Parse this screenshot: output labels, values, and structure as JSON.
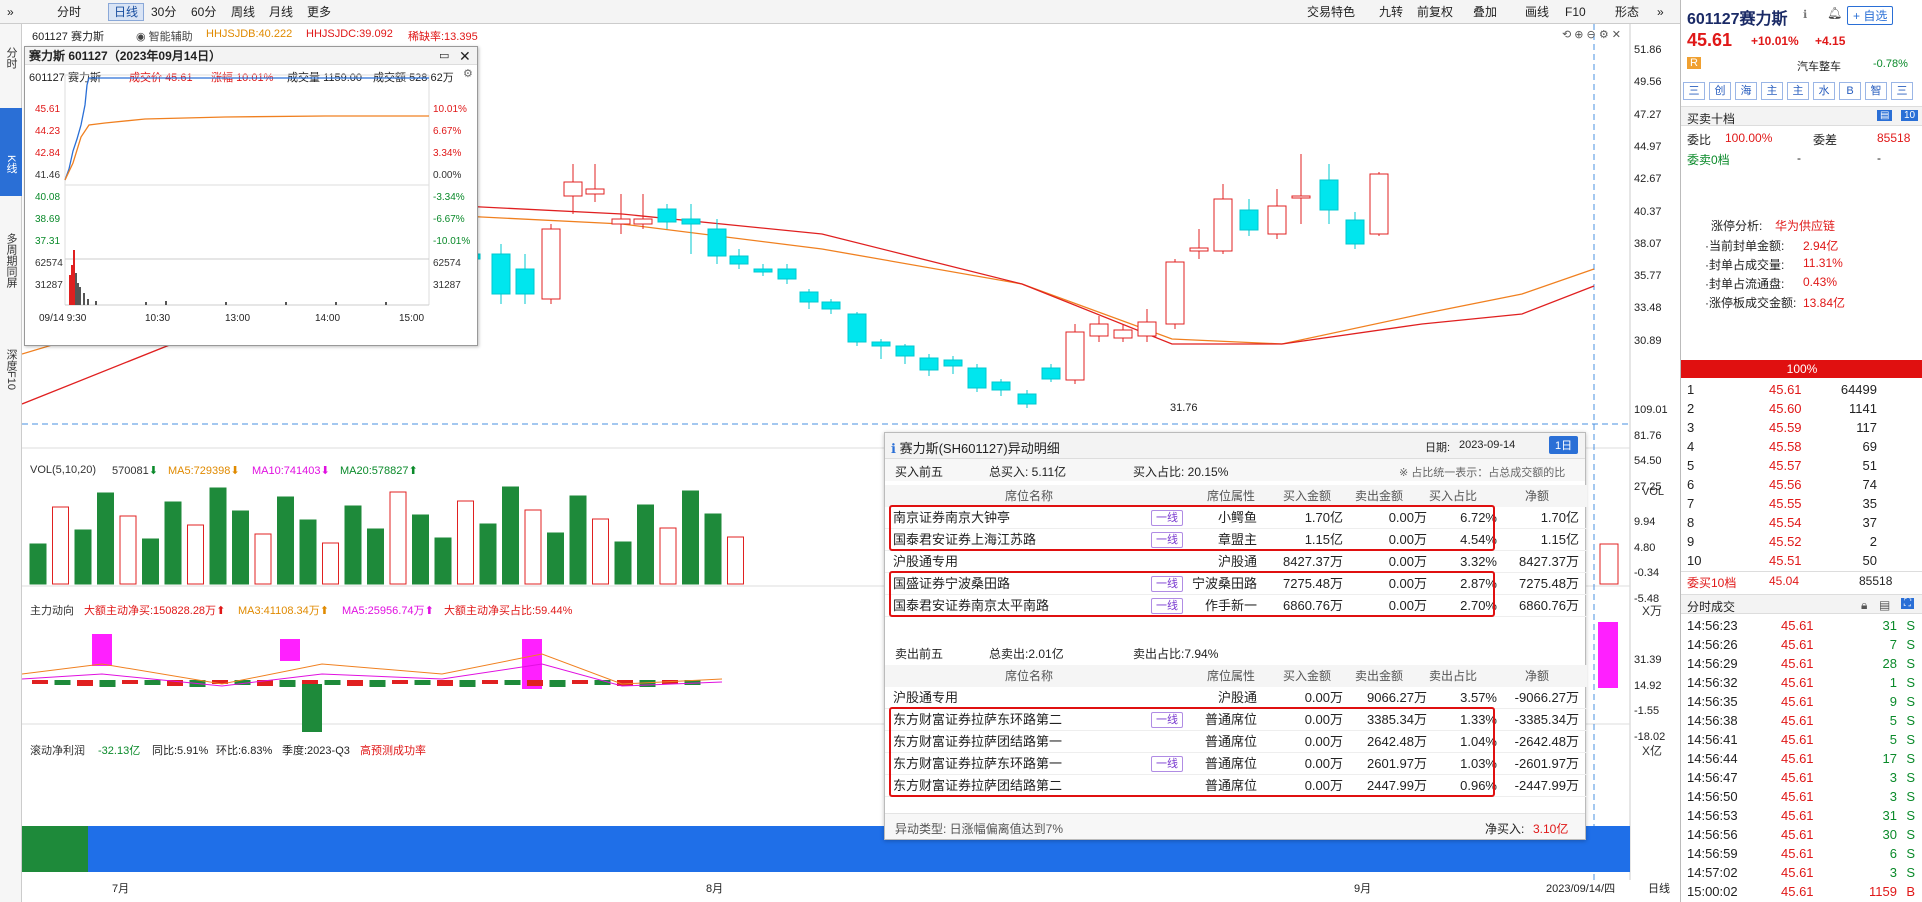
{
  "toolbar": {
    "periods": [
      "分时",
      "日线",
      "30分",
      "60分",
      "周线",
      "月线",
      "更多"
    ],
    "active": "日线",
    "right": [
      "交易特色",
      "九转",
      "前复权",
      "叠加",
      "画线",
      "F10",
      "形态"
    ]
  },
  "left_strip": {
    "top": "分时",
    "k": "K线",
    "multi": "多周期同屏",
    "depth": "深度F10"
  },
  "header": {
    "code": "601127",
    "name": "赛力斯",
    "assist": "智能辅助",
    "ind1": "HHJSJDB:40.222",
    "ind2": "HHJSJDC:39.092",
    "ind3": "稀缺率:13.395"
  },
  "main_axis": [
    "51.86",
    "49.56",
    "47.27",
    "44.97",
    "42.67",
    "40.37",
    "38.07",
    "35.77",
    "33.48",
    "30.89"
  ],
  "low_label": "31.76",
  "vol_legend": {
    "vol": "VOL(5,10,20)",
    "v": "570081",
    "ma5": "MA5:729398",
    "ma10": "MA10:741403",
    "ma20": "MA20:578827"
  },
  "vol_axis": [
    "109.01",
    "81.76",
    "54.50",
    "27.25"
  ],
  "vol_unit": "X万",
  "flow_legend": {
    "t": "主力动向",
    "a": "大额主动净买:150828.28万",
    "b": "MA3:41108.34万",
    "c": "MA5:25956.74万",
    "d": "大额主动净买占比:59.44%"
  },
  "flow_axis": [
    "9.94",
    "4.80",
    "-0.34",
    "-5.48"
  ],
  "flow_unit": "X亿",
  "profit_legend": {
    "t": "滚动净利润",
    "v": "-32.13亿",
    "yoy": "同比:5.91%",
    "qoq": "环比:6.83%",
    "q": "季度:2023-Q3",
    "pred": "高预测成功率"
  },
  "profit_axis": [
    "31.39",
    "14.92",
    "-1.55",
    "-18.02"
  ],
  "months": [
    "7月",
    "8月",
    "9月"
  ],
  "date_stamp": "2023/09/14/四",
  "bottom_tab": "日线",
  "mini": {
    "title": "赛力斯 601127（2023年09月14日）",
    "code": "601127 赛力斯",
    "price_l": "成交价",
    "price": "45.61",
    "chg_l": "涨幅",
    "chg": "10.01%",
    "vol_l": "成交量",
    "vol": "1159.00",
    "amt_l": "成交额",
    "amt": "528.62万",
    "left": [
      "45.61",
      "44.23",
      "42.84",
      "41.46",
      "40.08",
      "38.69",
      "37.31",
      "62574",
      "31287"
    ],
    "right": [
      "10.01%",
      "6.67%",
      "3.34%",
      "0.00%",
      "-3.34%",
      "-6.67%",
      "-10.01%",
      "62574",
      "31287"
    ],
    "times": [
      "09/14 9:30",
      "10:30",
      "13:00",
      "14:00",
      "15:00"
    ]
  },
  "popup": {
    "title": "赛力斯(SH601127)异动明细",
    "date_l": "日期:",
    "date": "2023-09-14",
    "day_btn": "1日",
    "buy": {
      "label": "买入前五",
      "total": "总买入: 5.11亿",
      "ratio": "买入占比: 20.15%",
      "note": "※ 占比统一表示：占总成交额的比"
    },
    "headers": [
      "席位名称",
      "席位属性",
      "买入金额",
      "卖出金额",
      "买入占比",
      "净额"
    ],
    "sell_headers": [
      "席位名称",
      "席位属性",
      "买入金额",
      "卖出金额",
      "卖出占比",
      "净额"
    ],
    "buy_rows": [
      {
        "name": "南京证券南京大钟亭",
        "tag": "一线",
        "attr": "小鳄鱼",
        "buy": "1.70亿",
        "sell": "0.00万",
        "pct": "6.72%",
        "net": "1.70亿"
      },
      {
        "name": "国泰君安证券上海江苏路",
        "tag": "一线",
        "attr": "章盟主",
        "buy": "1.15亿",
        "sell": "0.00万",
        "pct": "4.54%",
        "net": "1.15亿"
      },
      {
        "name": "沪股通专用",
        "tag": "",
        "attr": "沪股通",
        "buy": "8427.37万",
        "sell": "0.00万",
        "pct": "3.32%",
        "net": "8427.37万"
      },
      {
        "name": "国盛证券宁波桑田路",
        "tag": "一线",
        "attr": "宁波桑田路",
        "buy": "7275.48万",
        "sell": "0.00万",
        "pct": "2.87%",
        "net": "7275.48万"
      },
      {
        "name": "国泰君安证券南京太平南路",
        "tag": "一线",
        "attr": "作手新一",
        "buy": "6860.76万",
        "sell": "0.00万",
        "pct": "2.70%",
        "net": "6860.76万"
      }
    ],
    "sell": {
      "label": "卖出前五",
      "total": "总卖出:2.01亿",
      "ratio": "卖出占比:7.94%"
    },
    "sell_rows": [
      {
        "name": "沪股通专用",
        "tag": "",
        "attr": "沪股通",
        "buy": "0.00万",
        "sell": "9066.27万",
        "pct": "3.57%",
        "net": "-9066.27万"
      },
      {
        "name": "东方财富证券拉萨东环路第二",
        "tag": "一线",
        "attr": "普通席位",
        "buy": "0.00万",
        "sell": "3385.34万",
        "pct": "1.33%",
        "net": "-3385.34万"
      },
      {
        "name": "东方财富证券拉萨团结路第一",
        "tag": "",
        "attr": "普通席位",
        "buy": "0.00万",
        "sell": "2642.48万",
        "pct": "1.04%",
        "net": "-2642.48万"
      },
      {
        "name": "东方财富证券拉萨东环路第一",
        "tag": "一线",
        "attr": "普通席位",
        "buy": "0.00万",
        "sell": "2601.97万",
        "pct": "1.03%",
        "net": "-2601.97万"
      },
      {
        "name": "东方财富证券拉萨团结路第二",
        "tag": "",
        "attr": "普通席位",
        "buy": "0.00万",
        "sell": "2447.99万",
        "pct": "0.96%",
        "net": "-2447.99万"
      }
    ],
    "footer_type": "异动类型: 日涨幅偏离值达到7%",
    "footer_net_l": "净买入:",
    "footer_net": "3.10亿"
  },
  "quote": {
    "title": "601127赛力斯",
    "add": "自选",
    "price": "45.61",
    "chg_pct": "+10.01%",
    "chg": "+4.15",
    "r_badge": "R",
    "sector": "汽车整车",
    "sector_chg": "-0.78%",
    "tabs": [
      "三",
      "创",
      "海",
      "主",
      "主",
      "水",
      "B",
      "智",
      "三"
    ],
    "book_title": "买卖十档",
    "wb_l": "委比",
    "wb": "100.00%",
    "wc_l": "委差",
    "wc": "85518",
    "sell0": "委卖0档",
    "dash": "-",
    "analysis_t": "涨停分析:",
    "analysis_v": "华为供应链",
    "stats": [
      {
        "l": "·当前封单金额:",
        "v": "2.94亿"
      },
      {
        "l": "·封单占成交量:",
        "v": "11.31%"
      },
      {
        "l": "·封单占流通盘:",
        "v": "0.43%"
      },
      {
        "l": "·涨停板成交金额:",
        "v": "13.84亿"
      }
    ],
    "bar": "100%",
    "bids": [
      {
        "n": "1",
        "p": "45.61",
        "q": "64499"
      },
      {
        "n": "2",
        "p": "45.60",
        "q": "1141"
      },
      {
        "n": "3",
        "p": "45.59",
        "q": "117"
      },
      {
        "n": "4",
        "p": "45.58",
        "q": "69"
      },
      {
        "n": "5",
        "p": "45.57",
        "q": "51"
      },
      {
        "n": "6",
        "p": "45.56",
        "q": "74"
      },
      {
        "n": "7",
        "p": "45.55",
        "q": "35"
      },
      {
        "n": "8",
        "p": "45.54",
        "q": "37"
      },
      {
        "n": "9",
        "p": "45.52",
        "q": "2"
      },
      {
        "n": "10",
        "p": "45.51",
        "q": "50"
      }
    ],
    "buy10_l": "委买10档",
    "buy10_p": "45.04",
    "buy10_q": "85518",
    "ticks_title": "分时成交",
    "ticks": [
      {
        "t": "14:56:23",
        "p": "45.61",
        "q": "31",
        "s": "S"
      },
      {
        "t": "14:56:26",
        "p": "45.61",
        "q": "7",
        "s": "S"
      },
      {
        "t": "14:56:29",
        "p": "45.61",
        "q": "28",
        "s": "S"
      },
      {
        "t": "14:56:32",
        "p": "45.61",
        "q": "1",
        "s": "S"
      },
      {
        "t": "14:56:35",
        "p": "45.61",
        "q": "9",
        "s": "S"
      },
      {
        "t": "14:56:38",
        "p": "45.61",
        "q": "5",
        "s": "S"
      },
      {
        "t": "14:56:41",
        "p": "45.61",
        "q": "5",
        "s": "S"
      },
      {
        "t": "14:56:44",
        "p": "45.61",
        "q": "17",
        "s": "S"
      },
      {
        "t": "14:56:47",
        "p": "45.61",
        "q": "3",
        "s": "S"
      },
      {
        "t": "14:56:50",
        "p": "45.61",
        "q": "3",
        "s": "S"
      },
      {
        "t": "14:56:53",
        "p": "45.61",
        "q": "31",
        "s": "S"
      },
      {
        "t": "14:56:56",
        "p": "45.61",
        "q": "30",
        "s": "S"
      },
      {
        "t": "14:56:59",
        "p": "45.61",
        "q": "6",
        "s": "S"
      },
      {
        "t": "14:57:02",
        "p": "45.61",
        "q": "3",
        "s": "S"
      },
      {
        "t": "15:00:02",
        "p": "45.61",
        "q": "1159",
        "s": "B"
      }
    ]
  }
}
